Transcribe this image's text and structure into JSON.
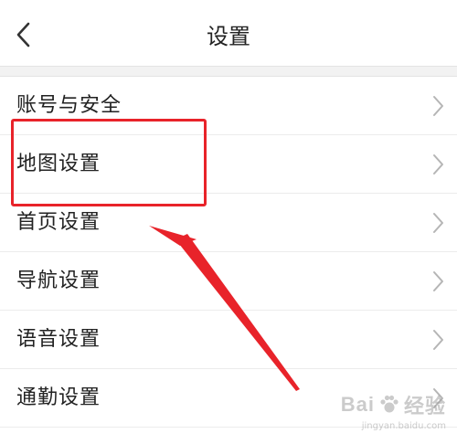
{
  "header": {
    "title": "设置",
    "back_icon": "chevron-left-icon"
  },
  "settings": {
    "items": [
      {
        "label": "账号与安全",
        "icon": "chevron-right-icon"
      },
      {
        "label": "地图设置",
        "icon": "chevron-right-icon"
      },
      {
        "label": "首页设置",
        "icon": "chevron-right-icon"
      },
      {
        "label": "导航设置",
        "icon": "chevron-right-icon"
      },
      {
        "label": "语音设置",
        "icon": "chevron-right-icon"
      },
      {
        "label": "通勤设置",
        "icon": "chevron-right-icon"
      }
    ]
  },
  "annotation": {
    "highlight_color": "#e8232a"
  },
  "watermark": {
    "brand_left": "Bai",
    "brand_right": "经验",
    "url": "jingyan.baidu.com"
  },
  "colors": {
    "text": "#222222",
    "chevron": "#b5b5b5",
    "divider": "#ececec",
    "band": "#f2f2f2"
  }
}
